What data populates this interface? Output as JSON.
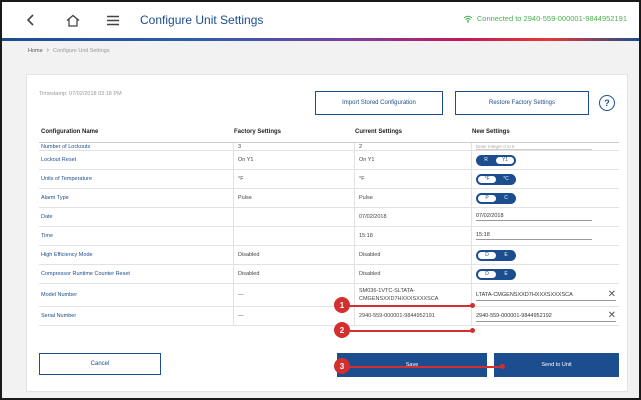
{
  "header": {
    "title": "Configure Unit Settings",
    "connection": "Connected to 2940-559-000001-9844952191"
  },
  "breadcrumb": {
    "home": "Home",
    "current": "Configure Unit Settings"
  },
  "card": {
    "timestamp": "Timestamp: 07/02/2018 03:18 PM",
    "import_label": "Import Stored Configuration",
    "restore_label": "Restore Factory Settings",
    "help_label": "?"
  },
  "table": {
    "headers": [
      "Configuration Name",
      "Factory Settings",
      "Current Settings",
      "New Settings"
    ],
    "partial_row": {
      "name": "Number of Lockouts",
      "factory": "3",
      "current": "2",
      "new": "Enter Integer 0 to 6"
    },
    "lockout_reset": {
      "name": "Lockout Reset",
      "factory": "On Y1",
      "current": "On Y1",
      "opt_a": "R",
      "opt_b": "Y1"
    },
    "units": {
      "name": "Units of Temperature",
      "factory": "°F",
      "current": "°F",
      "opt_a": "°F",
      "opt_b": "°C"
    },
    "alarm": {
      "name": "Alarm Type",
      "factory": "Pulse",
      "current": "Pulse",
      "opt_a": "P",
      "opt_b": "C"
    },
    "date": {
      "name": "Date",
      "factory": "",
      "current": "07/02/2018",
      "new": "07/02/2018"
    },
    "time": {
      "name": "Time",
      "factory": "",
      "current": "15:18",
      "new": "15:18"
    },
    "hem": {
      "name": "High Efficiency Mode",
      "factory": "Disabled",
      "current": "Disabled",
      "opt_a": "D",
      "opt_b": "E"
    },
    "crcr": {
      "name": "Compressor Runtime Counter Reset",
      "factory": "Disabled",
      "current": "Disabled",
      "opt_a": "D",
      "opt_b": "E"
    },
    "model": {
      "name": "Model Number",
      "factory": "—",
      "current": "SM036-1VTC-SLTATA-CMGENSXXD7HXXXSXXXSCA",
      "new": "LTATA-CMGENSXXD7HXXXSXXXSCA"
    },
    "serial": {
      "name": "Serial Number",
      "factory": "—",
      "current": "2940-559-000001-9844952191",
      "new": "2940-559-000001-9844952192"
    }
  },
  "actions": {
    "cancel": "Cancel",
    "save": "Save",
    "send": "Send to Unit"
  },
  "callouts": [
    "1",
    "2",
    "3"
  ],
  "colors": {
    "primary": "#1b4d8f",
    "connected": "#4caf50",
    "callout": "#d32f2f"
  },
  "icons": {
    "back": "chevron-left-icon",
    "home": "home-icon",
    "menu": "hamburger-menu-icon",
    "wifi": "wifi-icon",
    "clear": "close-icon"
  }
}
